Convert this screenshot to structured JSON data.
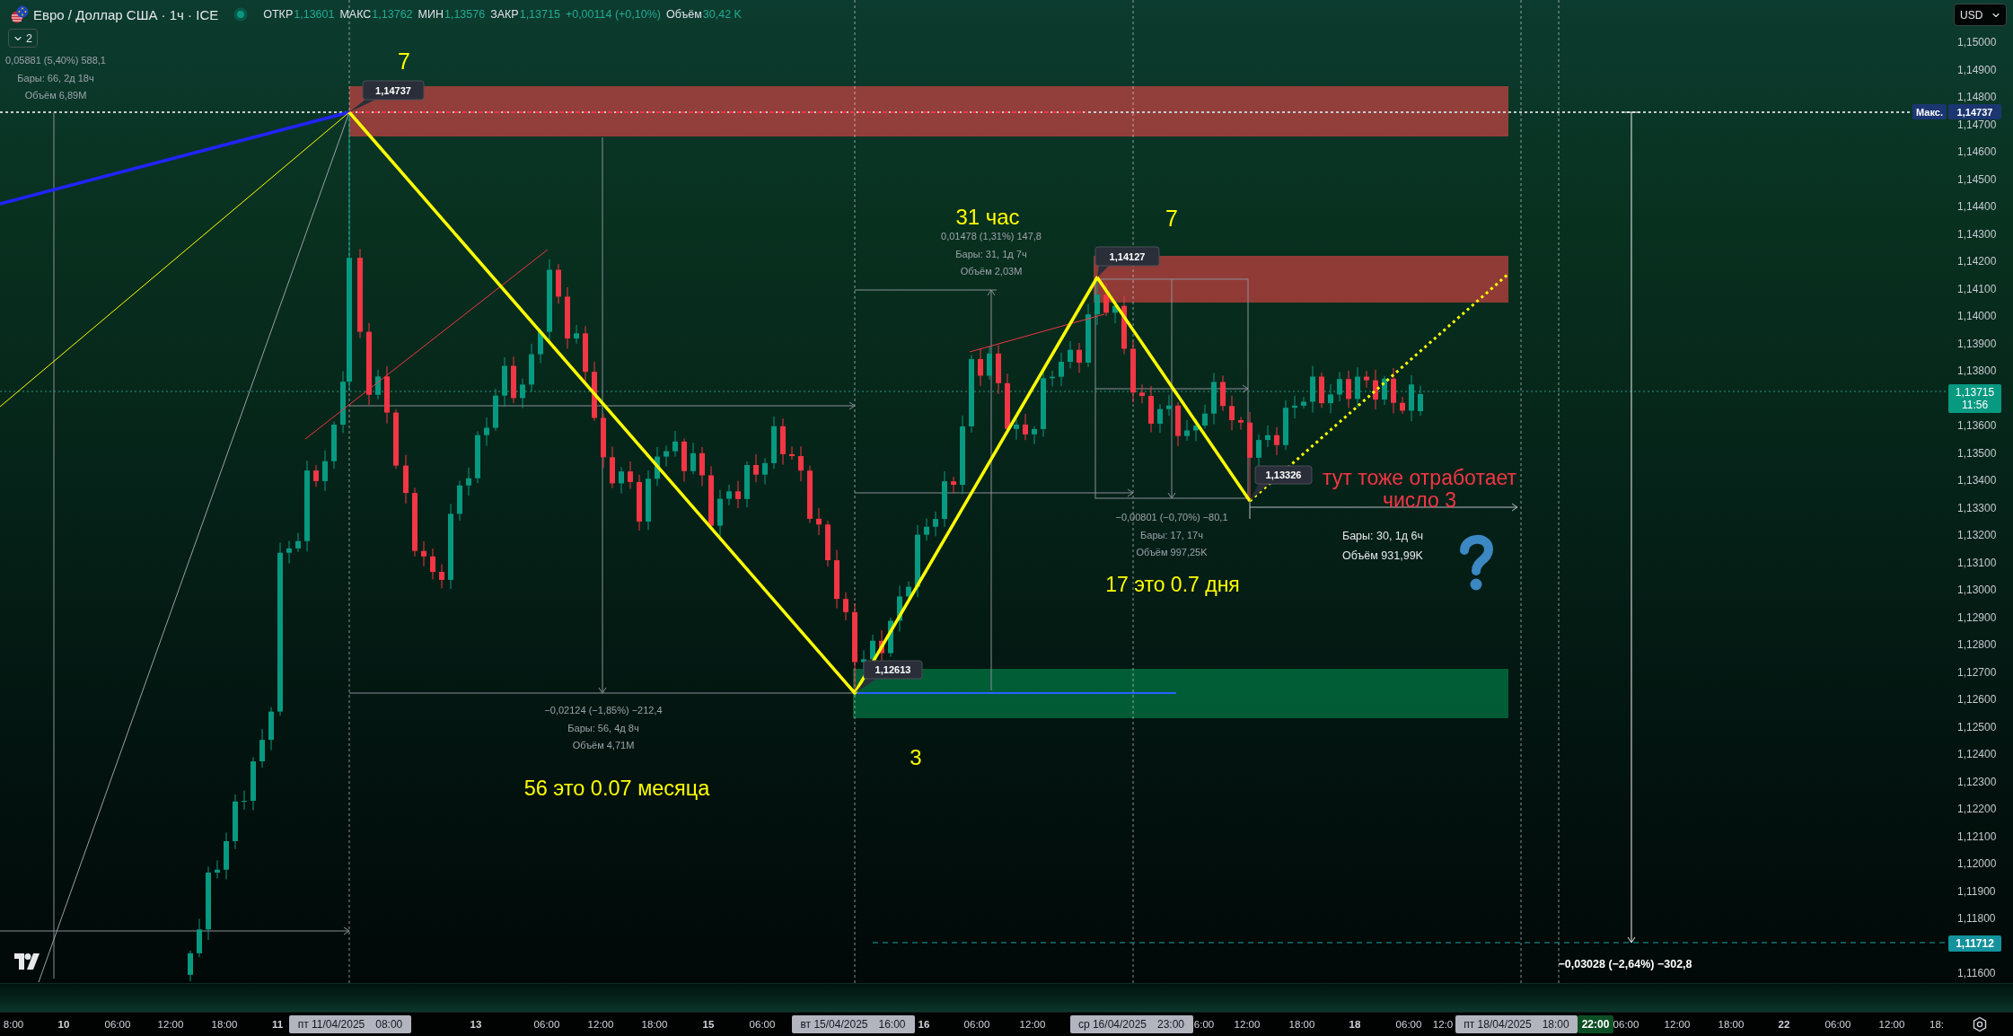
{
  "legend": {
    "symbol": "Евро / Доллар США · 1ч · ICE",
    "market_open": true,
    "fields": [
      {
        "label": "ОТКР",
        "value": "1,13601"
      },
      {
        "label": "МАКС",
        "value": "1,13762"
      },
      {
        "label": "МИН",
        "value": "1,13576"
      },
      {
        "label": "ЗАКР",
        "value": "1,13715"
      }
    ],
    "change": "+0,00114 (+0,10%)",
    "volume": {
      "label": "Объём",
      "value": "30,42 K"
    },
    "indicators_toggle": "2"
  },
  "currency_button": "USD",
  "measurements": [
    {
      "kind": "muted",
      "lines": [
        "0,05881 (5,40%) 588,1",
        "Бары: 66, 2д 18ч",
        "Объём 6,89M"
      ]
    },
    {
      "kind": "muted",
      "lines": [
        "−0,02124 (−1,85%) −212,4",
        "Бары: 56, 4д 8ч",
        "Объём 4,71M"
      ]
    },
    {
      "kind": "muted",
      "lines": [
        "0,01478 (1,31%) 147,8",
        "Бары: 31, 1д 7ч",
        "Объём 2,03M"
      ]
    },
    {
      "kind": "muted",
      "lines": [
        "−0,00801 (−0,70%) −80,1",
        "Бары: 17, 17ч",
        "Объём 997,25K"
      ]
    },
    {
      "kind": "bright",
      "lines": [
        "Бары: 30, 1д 6ч",
        "Объём 931,99K"
      ]
    },
    {
      "kind": "bold",
      "lines": [
        "−0,03028 (−2,64%) −302,8"
      ]
    }
  ],
  "price_callouts": [
    "1,14737",
    "1,14127",
    "1,12613",
    "1,13326"
  ],
  "notes": [
    {
      "text": "7",
      "color": "#ffff00"
    },
    {
      "text": "31 час",
      "color": "#ffff00"
    },
    {
      "text": "7",
      "color": "#ffff00"
    },
    {
      "text": "тут тоже отработает число 3",
      "color": "#f23645"
    },
    {
      "text": "17 это 0.7 дня",
      "color": "#ffff00"
    },
    {
      "text": "3",
      "color": "#ffff00"
    },
    {
      "text": "56 это 0.07 месяца",
      "color": "#ffff00"
    }
  ],
  "price_axis": {
    "labels": [
      "1,15000",
      "1,14900",
      "1,14800",
      "1,14700",
      "1,14600",
      "1,14500",
      "1,14400",
      "1,14300",
      "1,14200",
      "1,14100",
      "1,14000",
      "1,13900",
      "1,13800",
      "1,13600",
      "1,13500",
      "1,13400",
      "1,13300",
      "1,13200",
      "1,13100",
      "1,13000",
      "1,12900",
      "1,12800",
      "1,12700",
      "1,12600",
      "1,12500",
      "1,12400",
      "1,12300",
      "1,12200",
      "1,12100",
      "1,12000",
      "1,11900",
      "1,11800",
      "1,11600"
    ],
    "max_marker": {
      "label": "Макс.",
      "value": "1,14737"
    },
    "last_price": {
      "value": "1,13715",
      "countdown": "11:56"
    },
    "target_price": "1,11712"
  },
  "time_axis": {
    "ticks": [
      {
        "text": "8:00",
        "kind": "time"
      },
      {
        "text": "10",
        "kind": "day"
      },
      {
        "text": "06:00",
        "kind": "time"
      },
      {
        "text": "12:00",
        "kind": "time"
      },
      {
        "text": "18:00",
        "kind": "time"
      },
      {
        "text": "11",
        "kind": "day"
      },
      {
        "text": "13",
        "kind": "day"
      },
      {
        "text": "06:00",
        "kind": "time"
      },
      {
        "text": "12:00",
        "kind": "time"
      },
      {
        "text": "18:00",
        "kind": "time"
      },
      {
        "text": "15",
        "kind": "day"
      },
      {
        "text": "06:00",
        "kind": "time"
      },
      {
        "text": "16",
        "kind": "day"
      },
      {
        "text": "06:00",
        "kind": "time"
      },
      {
        "text": "12:00",
        "kind": "time"
      },
      {
        "text": "6:00",
        "kind": "time"
      },
      {
        "text": "12:00",
        "kind": "time"
      },
      {
        "text": "18:00",
        "kind": "time"
      },
      {
        "text": "18",
        "kind": "day"
      },
      {
        "text": "06:00",
        "kind": "time"
      },
      {
        "text": "12:0",
        "kind": "time"
      },
      {
        "text": "06:00",
        "kind": "time"
      },
      {
        "text": "12:00",
        "kind": "time"
      },
      {
        "text": "18:00",
        "kind": "time"
      },
      {
        "text": "22",
        "kind": "day"
      },
      {
        "text": "06:00",
        "kind": "time"
      },
      {
        "text": "12:00",
        "kind": "time"
      },
      {
        "text": "18:",
        "kind": "time"
      }
    ],
    "markers": [
      {
        "kind": "date",
        "date": "пт 11/04/2025",
        "time": "08:00"
      },
      {
        "kind": "date",
        "date": "вт 15/04/2025",
        "time": "16:00"
      },
      {
        "kind": "date",
        "date": "ср 16/04/2025",
        "time": "23:00"
      },
      {
        "kind": "date",
        "date": "пт 18/04/2025",
        "time": "18:00"
      },
      {
        "kind": "current",
        "time": "22:00"
      }
    ]
  }
}
